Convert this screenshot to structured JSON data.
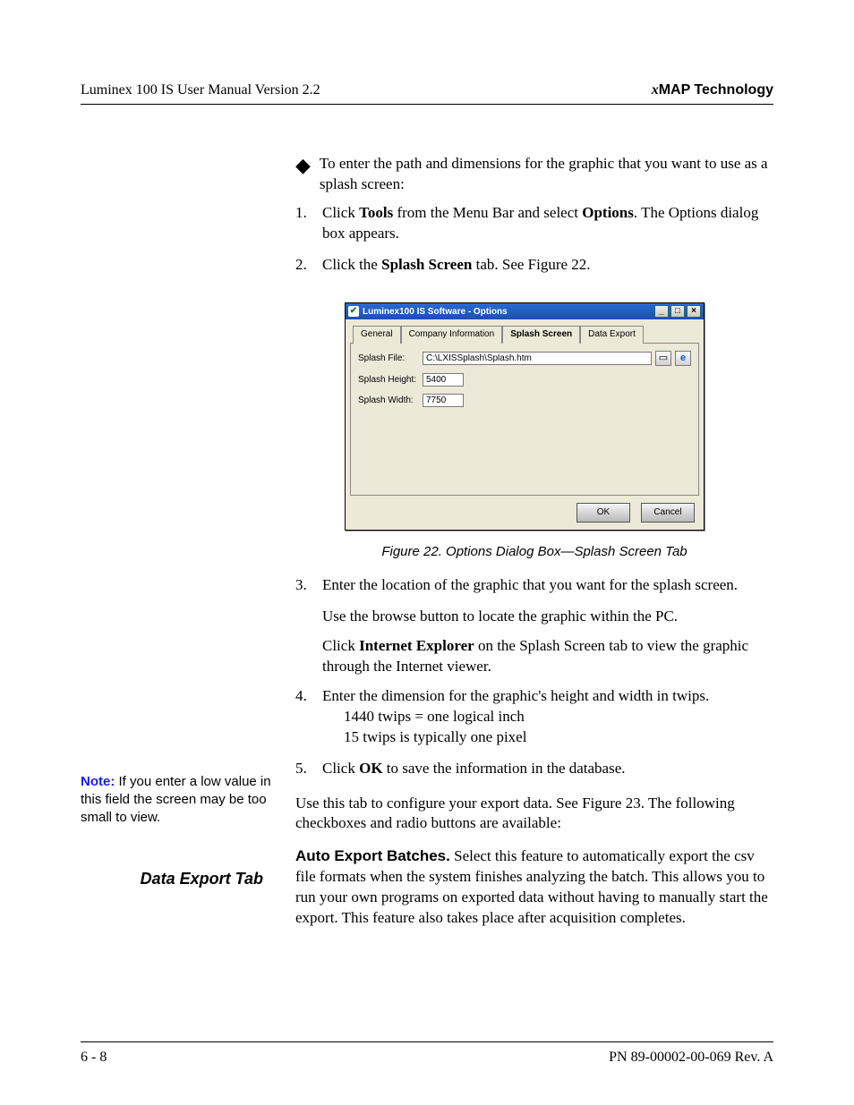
{
  "header": {
    "left": "Luminex 100 IS User Manual Version 2.2",
    "right_prefix": "x",
    "right_rest": "MAP Technology"
  },
  "intro": {
    "lead": "To enter the path and dimensions for the graphic that you want to use as a splash screen:"
  },
  "steps_a": {
    "s1_pre": "Click ",
    "s1_b1": "Tools",
    "s1_mid": " from the Menu Bar and select ",
    "s1_b2": "Options",
    "s1_post": ". The Options dialog box appears.",
    "s2_pre": "Click the ",
    "s2_b1": "Splash Screen",
    "s2_post": " tab. See Figure 22."
  },
  "dialog": {
    "title": "Luminex100 IS Software - Options",
    "tabs": {
      "t0": "General",
      "t1": "Company Information",
      "t2": "Splash Screen",
      "t3": "Data Export"
    },
    "labels": {
      "file": "Splash File:",
      "height": "Splash Height:",
      "width": "Splash Width:"
    },
    "values": {
      "file": "C:\\LXISSplash\\Splash.htm",
      "height": "5400",
      "width": "7750"
    },
    "buttons": {
      "ok": "OK",
      "cancel": "Cancel"
    },
    "winbtns": {
      "min": "_",
      "max": "□",
      "close": "×"
    }
  },
  "caption": "Figure 22.  Options Dialog Box—Splash Screen Tab",
  "steps_b": {
    "s3_main": "Enter the location of the graphic that you want for the splash screen.",
    "s3_p2": "Use the browse button to locate the graphic within the PC.",
    "s3_p3_pre": "Click ",
    "s3_p3_b": "Internet Explorer",
    "s3_p3_post": " on the Splash Screen tab to view the graphic through the Internet viewer.",
    "s4_main": "Enter the dimension for the graphic's height and width in twips.",
    "s4_sub1": "1440 twips = one logical inch",
    "s4_sub2": "15 twips is typically one pixel",
    "s5_pre": "Click ",
    "s5_b": "OK",
    "s5_post": " to save the information in the database."
  },
  "note": {
    "label": "Note:",
    "text": " If you enter a low value in this field the screen may be too small to view."
  },
  "section_heading": "Data Export Tab",
  "data_export": {
    "p1": "Use this tab to configure your export data. See Figure 23. The following checkboxes and radio buttons are available:",
    "p2_runin": "Auto Export Batches.",
    "p2_body": " Select this feature to automatically export the csv file formats when the system finishes analyzing the batch. This allows you to run your own programs on exported data without having to manually start the export. This feature also takes place after acquisition completes."
  },
  "footer": {
    "left": "6 - 8",
    "right": "PN 89-00002-00-069 Rev. A"
  }
}
